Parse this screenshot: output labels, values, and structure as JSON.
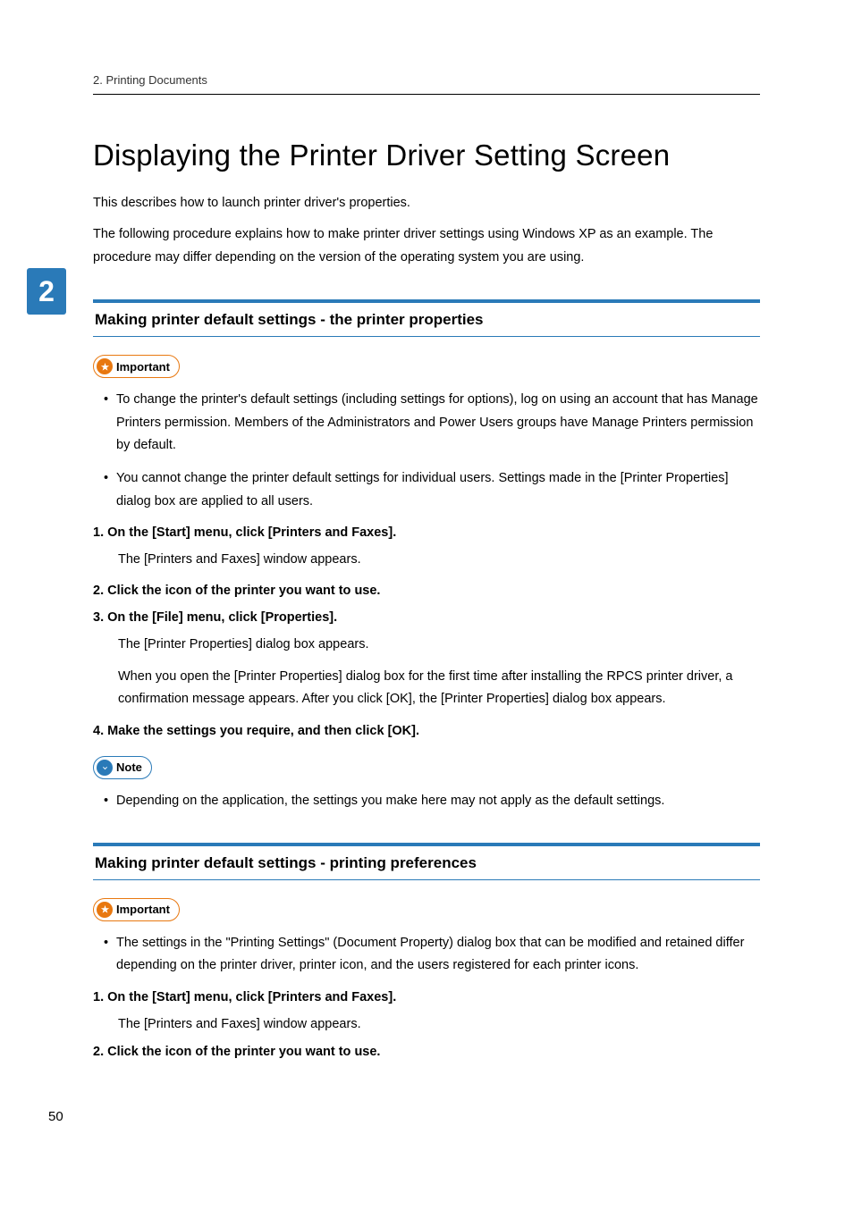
{
  "header": {
    "breadcrumb": "2. Printing Documents"
  },
  "chapterTab": "2",
  "title": "Displaying the Printer Driver Setting Screen",
  "intro1": "This describes how to launch printer driver's properties.",
  "intro2": "The following procedure explains how to make printer driver settings using Windows XP as an example. The procedure may differ depending on the version of the operating system you are using.",
  "section1": {
    "heading": "Making printer default settings - the printer properties",
    "importantLabel": "Important",
    "importantBullets": [
      "To change the printer's default settings (including settings for options), log on using an account that has Manage Printers permission. Members of the Administrators and Power Users groups have Manage Printers permission by default.",
      "You cannot change the printer default settings for individual users. Settings made in the [Printer Properties] dialog box are applied to all users."
    ],
    "steps": {
      "s1": "1. On the [Start] menu, click [Printers and Faxes].",
      "s1body": "The [Printers and Faxes] window appears.",
      "s2": "2. Click the icon of the printer you want to use.",
      "s3": "3. On the [File] menu, click [Properties].",
      "s3body1": "The [Printer Properties] dialog box appears.",
      "s3body2": "When you open the [Printer Properties] dialog box for the first time after installing the RPCS printer driver, a confirmation message appears. After you click [OK], the [Printer Properties] dialog box appears.",
      "s4": "4. Make the settings you require, and then click [OK]."
    },
    "noteLabel": "Note",
    "noteBullets": [
      "Depending on the application, the settings you make here may not apply as the default settings."
    ]
  },
  "section2": {
    "heading": "Making printer default settings - printing preferences",
    "importantLabel": "Important",
    "importantBullets": [
      "The settings in the \"Printing Settings\" (Document Property) dialog box that can be modified and retained differ depending on the printer driver, printer icon, and the users registered for each printer icons."
    ],
    "steps": {
      "s1": "1. On the [Start] menu, click [Printers and Faxes].",
      "s1body": "The [Printers and Faxes] window appears.",
      "s2": "2. Click the icon of the printer you want to use."
    }
  },
  "pageNumber": "50"
}
